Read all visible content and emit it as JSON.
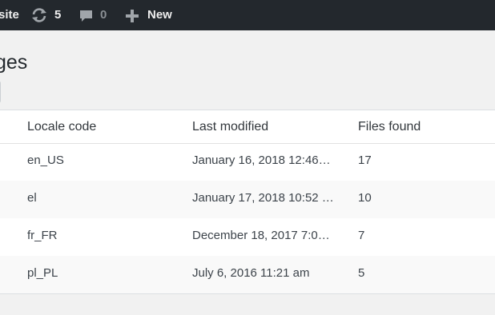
{
  "admin_bar": {
    "site_label": "site",
    "updates_count": "5",
    "comments_count": "0",
    "new_label": "New"
  },
  "page": {
    "title": "ges"
  },
  "table": {
    "columns": [
      "Locale code",
      "Last modified",
      "Files found"
    ],
    "rows": [
      {
        "name": ".",
        "locale": "en_US",
        "modified": "January 16, 2018 12:46…",
        "files": "17"
      },
      {
        "name": "",
        "locale": "el",
        "modified": "January 17, 2018 10:52 …",
        "files": "10"
      },
      {
        "name": "",
        "locale": "fr_FR",
        "modified": "December 18, 2017 7:0…",
        "files": "7"
      },
      {
        "name": "",
        "locale": "pl_PL",
        "modified": "July 6, 2016 11:21 am",
        "files": "5"
      }
    ]
  }
}
